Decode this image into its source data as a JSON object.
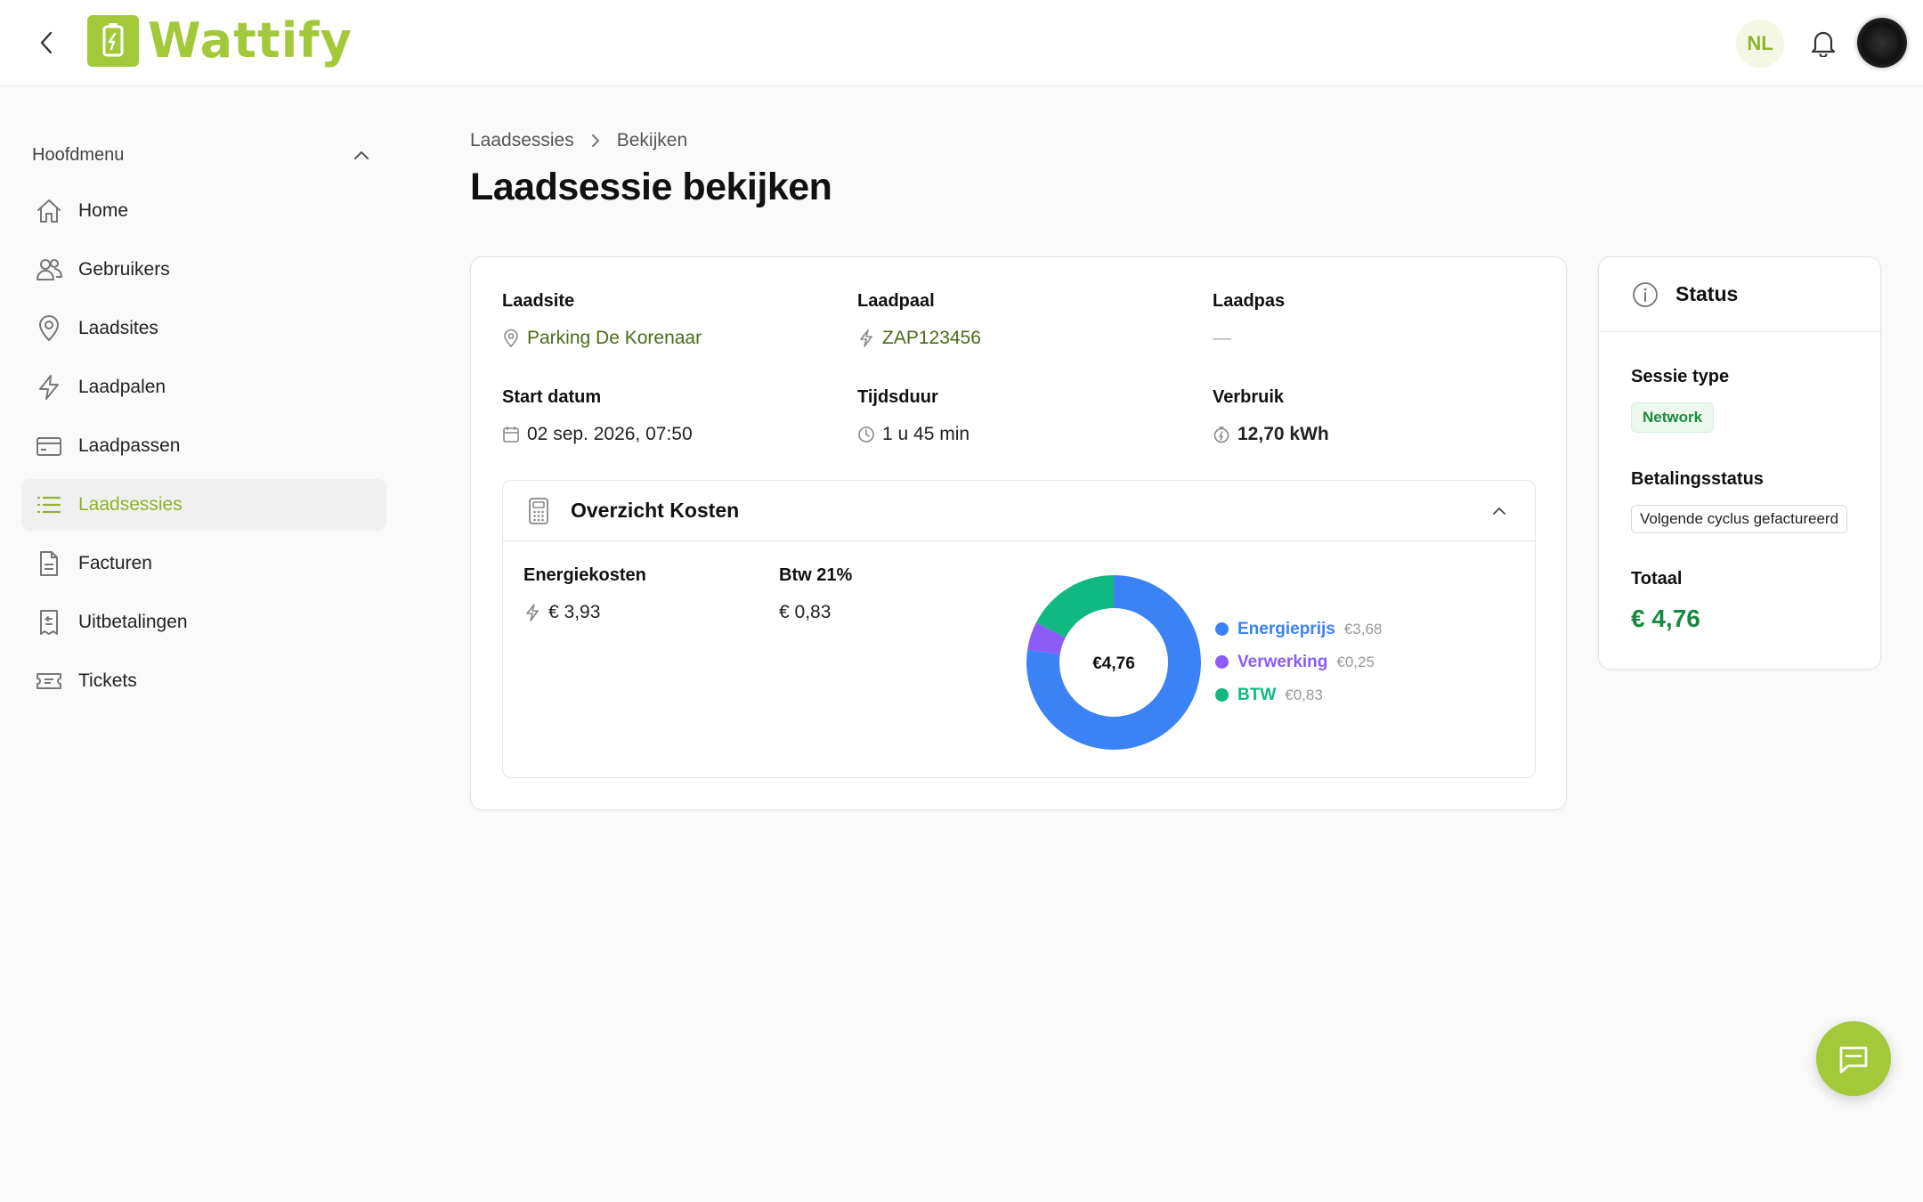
{
  "header": {
    "logo_text": "Wattify",
    "language": "NL"
  },
  "sidebar": {
    "section_title": "Hoofdmenu",
    "items": [
      {
        "label": "Home",
        "icon": "home-icon"
      },
      {
        "label": "Gebruikers",
        "icon": "users-icon"
      },
      {
        "label": "Laadsites",
        "icon": "map-pin-icon"
      },
      {
        "label": "Laadpalen",
        "icon": "lightning-icon"
      },
      {
        "label": "Laadpassen",
        "icon": "card-icon"
      },
      {
        "label": "Laadsessies",
        "icon": "list-icon",
        "active": true
      },
      {
        "label": "Facturen",
        "icon": "document-icon"
      },
      {
        "label": "Uitbetalingen",
        "icon": "receipt-icon"
      },
      {
        "label": "Tickets",
        "icon": "ticket-icon"
      }
    ]
  },
  "breadcrumb": {
    "parent": "Laadsessies",
    "current": "Bekijken"
  },
  "page": {
    "title": "Laadsessie bekijken"
  },
  "details": {
    "laadsite": {
      "label": "Laadsite",
      "value": "Parking De Korenaar"
    },
    "laadpaal": {
      "label": "Laadpaal",
      "value": "ZAP123456"
    },
    "laadpas": {
      "label": "Laadpas",
      "value": "—"
    },
    "start_datum": {
      "label": "Start datum",
      "value": "02 sep. 2026, 07:50"
    },
    "tijdsduur": {
      "label": "Tijdsduur",
      "value": "1 u 45 min"
    },
    "verbruik": {
      "label": "Verbruik",
      "value": "12,70 kWh"
    }
  },
  "costs": {
    "title": "Overzicht Kosten",
    "energiekosten": {
      "label": "Energiekosten",
      "value": "€ 3,93"
    },
    "btw": {
      "label": "Btw 21%",
      "value": "€ 0,83"
    },
    "center_label": "€4,76"
  },
  "chart_data": {
    "type": "pie",
    "categories": [
      "Energieprijs",
      "Verwerking",
      "BTW"
    ],
    "values": [
      3.68,
      0.25,
      0.83
    ],
    "value_labels": [
      "€3,68",
      "€0,25",
      "€0,83"
    ],
    "colors": [
      "#3b82f6",
      "#8b5cf6",
      "#10b981"
    ],
    "legend_position": "right"
  },
  "status": {
    "title": "Status",
    "sessie_type_label": "Sessie type",
    "sessie_type_value": "Network",
    "betalingsstatus_label": "Betalingsstatus",
    "betalingsstatus_value": "Volgende cyclus gefactureerd",
    "totaal_label": "Totaal",
    "totaal_value": "€ 4,76"
  },
  "colors": {
    "brand": "#a3c93a",
    "success": "#16883f"
  }
}
